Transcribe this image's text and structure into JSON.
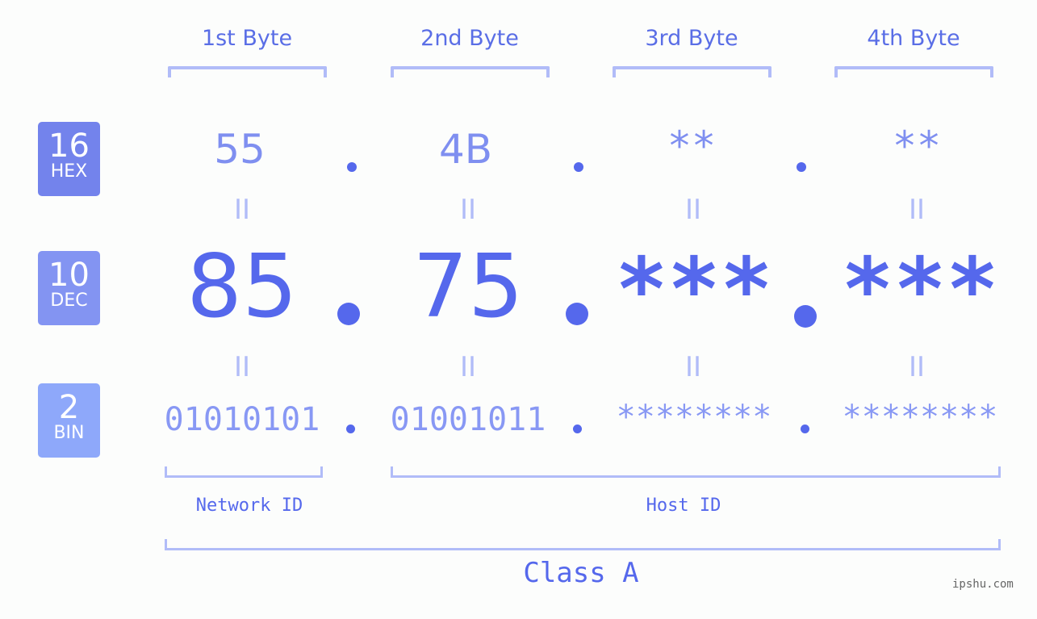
{
  "bytes": [
    {
      "header": "1st Byte",
      "hex": "55",
      "dec": "85",
      "bin": "01010101"
    },
    {
      "header": "2nd Byte",
      "hex": "4B",
      "dec": "75",
      "bin": "01001011"
    },
    {
      "header": "3rd Byte",
      "hex": "**",
      "dec": "***",
      "bin": "********"
    },
    {
      "header": "4th Byte",
      "hex": "**",
      "dec": "***",
      "bin": "********"
    }
  ],
  "badges": {
    "hex": {
      "base": "16",
      "label": "HEX",
      "color": "#7383ec"
    },
    "dec": {
      "base": "10",
      "label": "DEC",
      "color": "#8394f2"
    },
    "bin": {
      "base": "2",
      "label": "BIN",
      "color": "#8ea8fa"
    }
  },
  "equals_sign": "II",
  "network_label": "Network ID",
  "host_label": "Host ID",
  "class_label": "Class A",
  "watermark": "ipshu.com",
  "colors": {
    "accent": "#5568ec",
    "light_accent": "#b1bcf8",
    "hex_text": "#7f8ff0",
    "bin_text": "#8898f4"
  }
}
